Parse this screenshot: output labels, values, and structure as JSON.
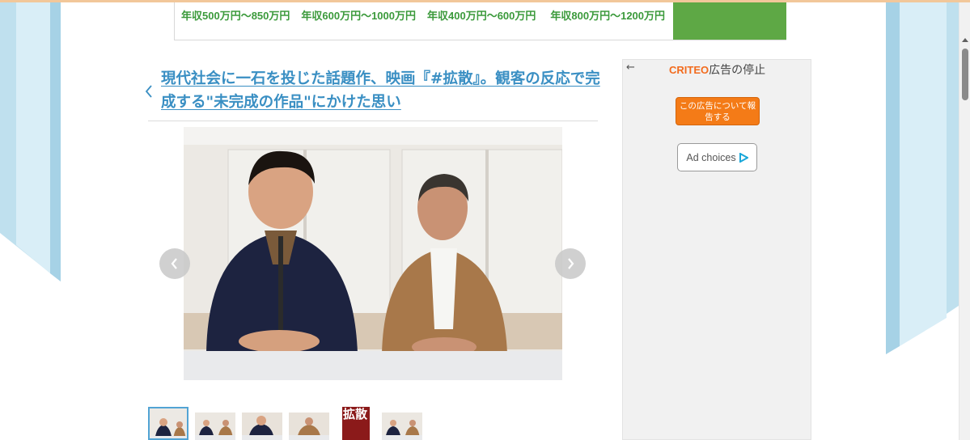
{
  "salary_banner": {
    "items": [
      "年収500万円〜850万円",
      "年収600万円〜1000万円",
      "年収400万円〜600万円",
      "年収800万円〜1200万円"
    ]
  },
  "article": {
    "title": "現代社会に一石を投じた話題作、映画『#拡散』。観客の反応で完成する\"未完成の作品\"にかけた思い",
    "book_thumb_text": "拡散"
  },
  "ad": {
    "back_label": "←",
    "brand": "CRITEO",
    "stop_label": "広告の停止",
    "report_label": "この広告について報告する",
    "choices_label": "Ad choices"
  },
  "colors": {
    "title_link": "#3a8fc3",
    "salary_text": "#3b9a3b",
    "banner_green": "#5ea845",
    "ad_report": "#f47b17",
    "criteo_brand": "#f26b1d",
    "thumb_active_border": "#52a4d4"
  },
  "icons": {
    "back": "chevron-left-icon",
    "prev": "chevron-left-icon",
    "next": "chevron-right-icon",
    "ad_choices": "play-triangle-icon"
  }
}
